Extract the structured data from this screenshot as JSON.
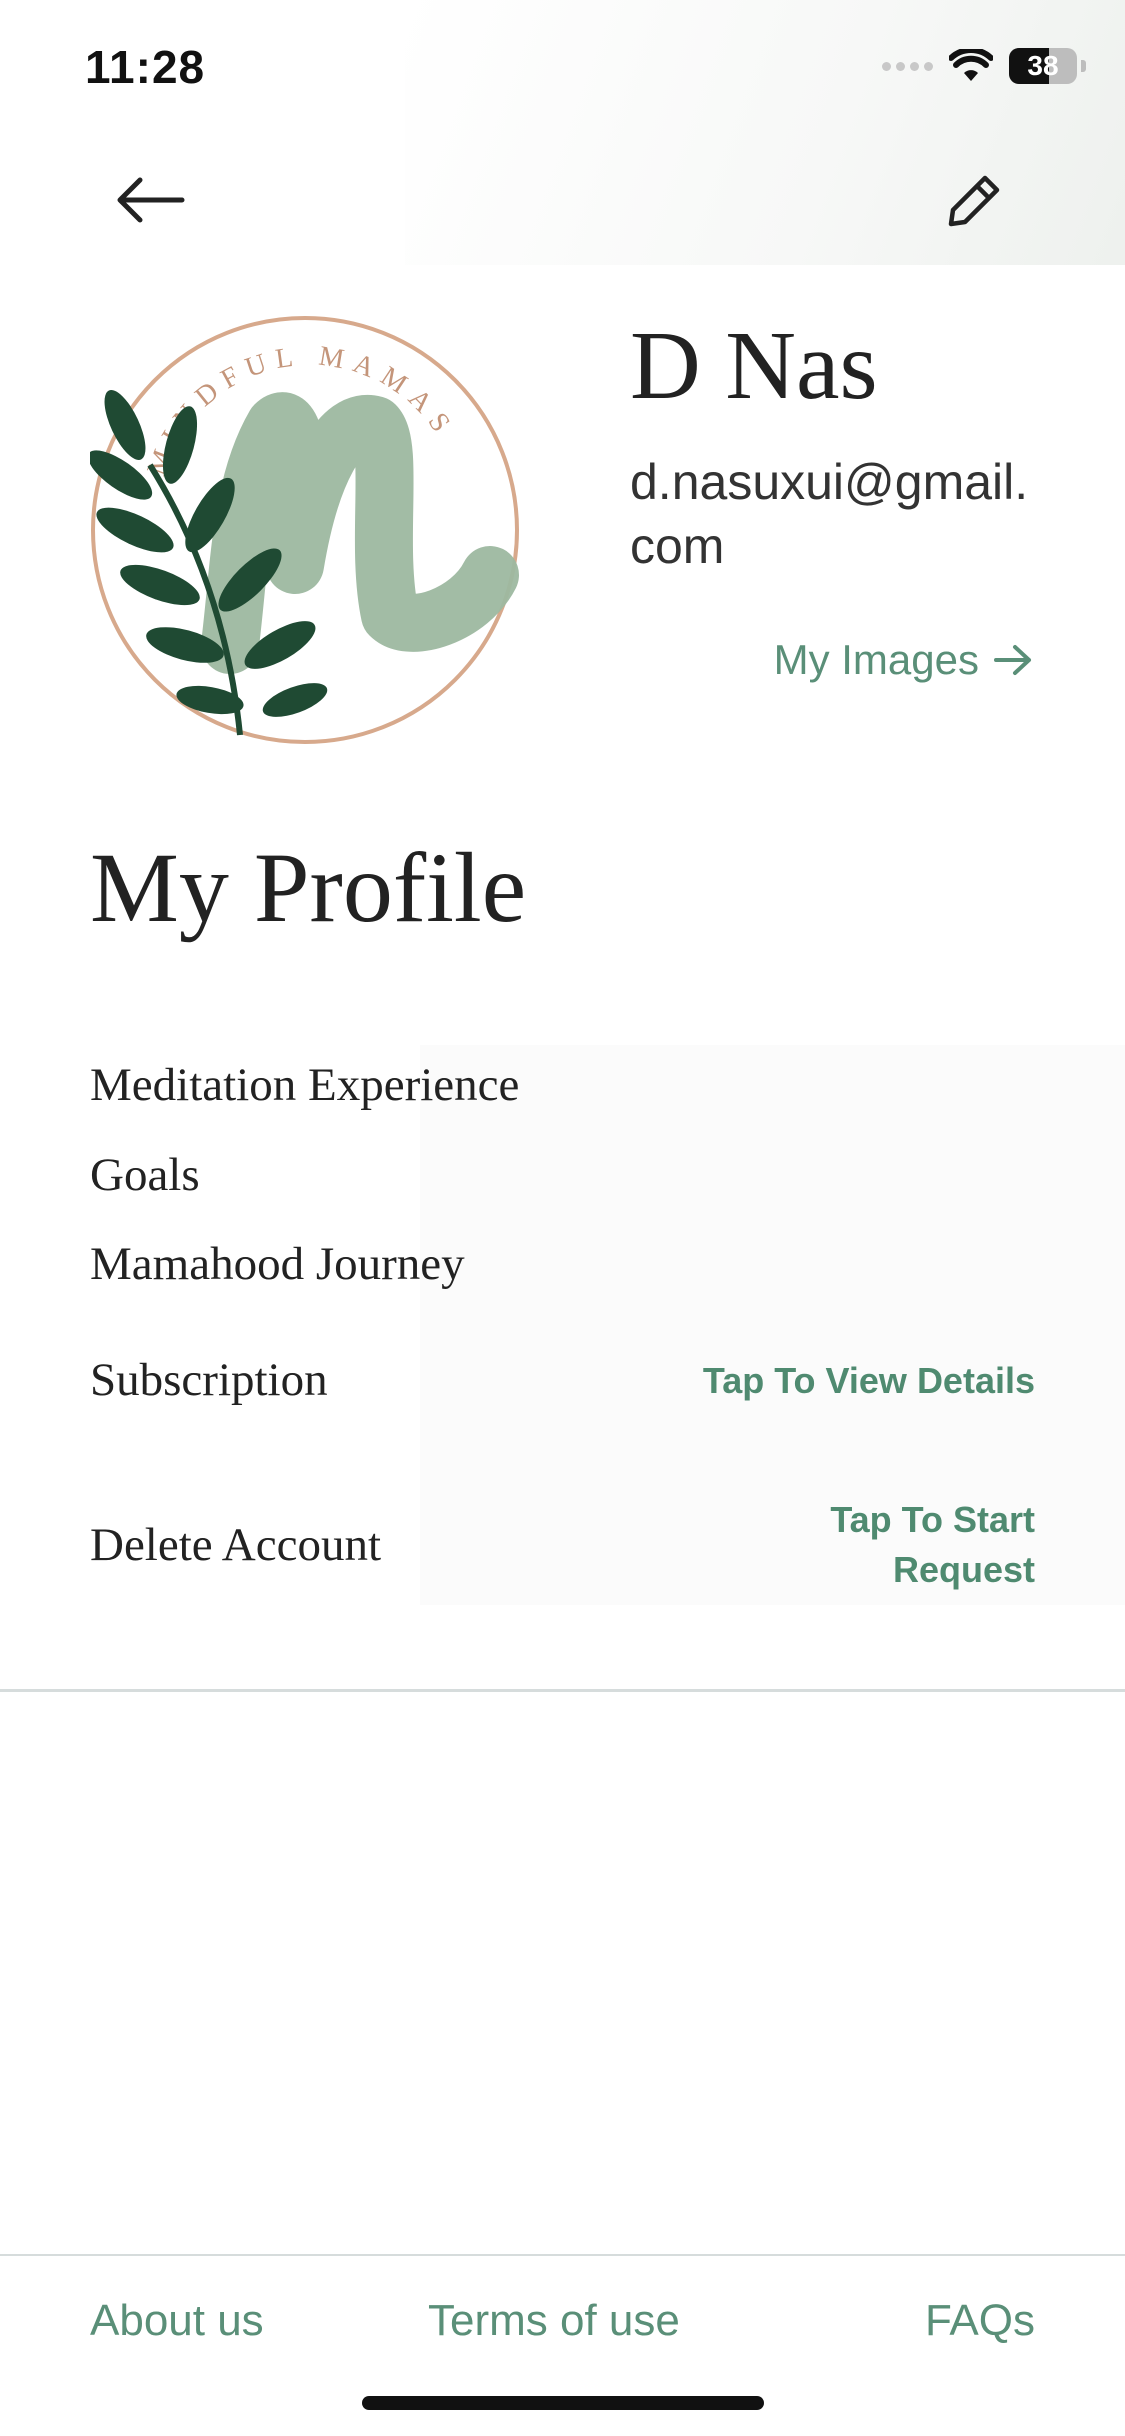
{
  "status_bar": {
    "time": "11:28",
    "battery": "38"
  },
  "header": {
    "back_icon": "arrow-left-icon",
    "edit_icon": "pencil-icon"
  },
  "profile": {
    "logo_text": "MINDFUL MAMAS",
    "name": "D Nas",
    "email": "d.nasuxui@gmail.com",
    "my_images_label": "My Images",
    "my_images_icon": "arrow-right-icon"
  },
  "page_title": "My Profile",
  "menu": {
    "meditation": "Meditation Experience",
    "goals": "Goals",
    "journey": "Mamahood Journey",
    "subscription": "Subscription",
    "subscription_action": "Tap To View Details",
    "delete_account": "Delete Account",
    "delete_action_line1": "Tap To Start",
    "delete_action_line2": "Request"
  },
  "footer": {
    "about": "About us",
    "terms": "Terms of use",
    "faqs": "FAQs"
  },
  "colors": {
    "accent": "#5a8f78",
    "text": "#222222",
    "divider": "#d6dcdc",
    "logo_ring": "#d7a98c",
    "logo_m": "#9db8a0",
    "leaf": "#1f4a33"
  }
}
